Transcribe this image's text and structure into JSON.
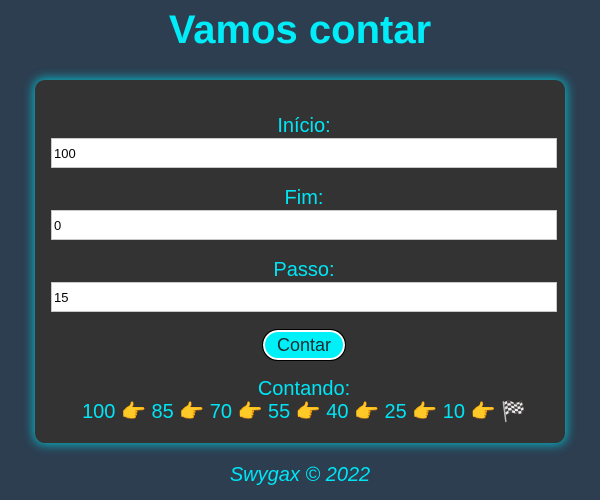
{
  "header": {
    "title": "Vamos contar"
  },
  "form": {
    "start": {
      "label": "Início:",
      "value": "100"
    },
    "end": {
      "label": "Fim:",
      "value": "0"
    },
    "step": {
      "label": "Passo:",
      "value": "15"
    },
    "button_label": "Contar"
  },
  "result": {
    "label": "Contando:",
    "sequence": "100 👉 85 👉 70 👉 55 👉 40 👉 25 👉 10 👉 🏁"
  },
  "footer": {
    "text": "Swygax © 2022"
  },
  "colors": {
    "background": "#2c3e50",
    "card": "#333333",
    "accent": "#00e5f5"
  }
}
